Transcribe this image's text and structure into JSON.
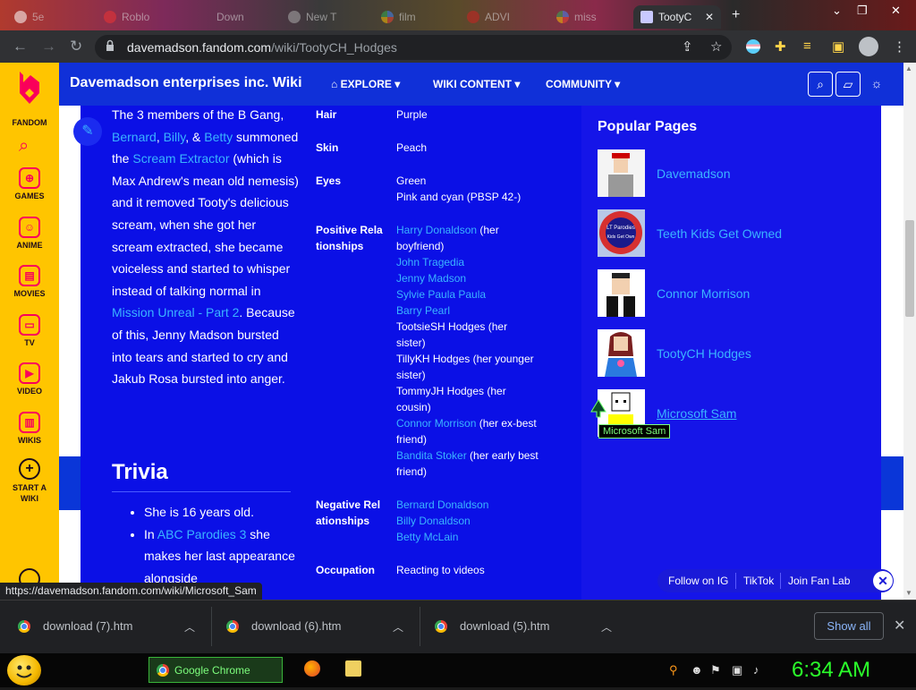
{
  "browser": {
    "tabs": [
      {
        "label": "5e"
      },
      {
        "label": "Roblo"
      },
      {
        "label": "Down"
      },
      {
        "label": "New T"
      },
      {
        "label": "film"
      },
      {
        "label": "ADVI"
      },
      {
        "label": "miss"
      },
      {
        "label": "TootyC"
      }
    ],
    "new_tab_label": "+",
    "url_domain": "davemadson.fandom.com",
    "url_path": "/wiki/TootyCH_Hodges"
  },
  "fandom_rail": {
    "logo_label": "FANDOM",
    "items": [
      {
        "label": "GAMES",
        "icon": "gamepad-icon"
      },
      {
        "label": "ANIME",
        "icon": "anime-icon"
      },
      {
        "label": "MOVIES",
        "icon": "movies-icon"
      },
      {
        "label": "TV",
        "icon": "tv-icon"
      },
      {
        "label": "VIDEO",
        "icon": "video-icon"
      },
      {
        "label": "WIKIS",
        "icon": "book-icon"
      },
      {
        "label": "START A WIKI",
        "icon": "plus-icon"
      }
    ]
  },
  "wiki_header": {
    "title": "Davemadson enterprises inc. Wiki",
    "nav": [
      "EXPLORE",
      "WIKI CONTENT",
      "COMMUNITY"
    ]
  },
  "article": {
    "paragraph": [
      {
        "t": "The 3 members of the B Gang, "
      },
      {
        "t": "Bernard",
        "link": true
      },
      {
        "t": ", "
      },
      {
        "t": "Billy",
        "link": true
      },
      {
        "t": ", & "
      },
      {
        "t": "Betty",
        "link": true
      },
      {
        "t": " summoned the "
      },
      {
        "t": "Scream Extractor",
        "link": true
      },
      {
        "t": " (which is Max Andrew's mean old nemesis) and it removed Tooty's delicious scream, when she got her scream extracted, she became voiceless and started to whisper instead of talking normal in "
      },
      {
        "t": "Mission Unreal - Part 2",
        "link": true
      },
      {
        "t": ". Because of this, Jenny Madson bursted into tears and started to cry and Jakub Rosa bursted into anger."
      }
    ],
    "trivia_heading": "Trivia",
    "trivia_items": [
      [
        {
          "t": "She is 16 years old."
        }
      ],
      [
        {
          "t": "In "
        },
        {
          "t": "ABC Parodies 3",
          "link": true
        },
        {
          "t": " she makes her last appearance alongside"
        }
      ]
    ]
  },
  "infobox": [
    {
      "label": "Hair",
      "values": [
        [
          {
            "t": "Purple"
          }
        ]
      ]
    },
    {
      "label": "Skin",
      "values": [
        [
          {
            "t": "Peach"
          }
        ]
      ]
    },
    {
      "label": "Eyes",
      "values": [
        [
          {
            "t": "Green"
          }
        ],
        [
          {
            "t": "Pink and cyan (PBSP 42-)"
          }
        ]
      ]
    },
    {
      "label": "Positive Relationships",
      "values": [
        [
          {
            "t": "Harry Donaldson",
            "link": true
          },
          {
            "t": " (her boyfriend)"
          }
        ],
        [
          {
            "t": "John Tragedia",
            "link": true
          }
        ],
        [
          {
            "t": "Jenny Madson",
            "link": true
          }
        ],
        [
          {
            "t": "Sylvie Paula Paula",
            "link": true
          }
        ],
        [
          {
            "t": "Barry Pearl",
            "link": true
          }
        ],
        [
          {
            "t": "TootsieSH Hodges (her sister)"
          }
        ],
        [
          {
            "t": "TillyKH Hodges (her younger sister)"
          }
        ],
        [
          {
            "t": "TommyJH Hodges (her cousin)"
          }
        ],
        [
          {
            "t": "Connor Morrison",
            "link": true
          },
          {
            "t": " (her ex-best friend)"
          }
        ],
        [
          {
            "t": "Bandita Stoker",
            "link": true
          },
          {
            "t": " (her early best friend)"
          }
        ]
      ]
    },
    {
      "label": "Negative Relationships",
      "values": [
        [
          {
            "t": "Bernard Donaldson",
            "link": true
          }
        ],
        [
          {
            "t": "Billy Donaldson",
            "link": true
          }
        ],
        [
          {
            "t": "Betty McLain",
            "link": true
          }
        ]
      ]
    },
    {
      "label": "Occupation",
      "values": [
        [
          {
            "t": "Reacting to videos"
          }
        ]
      ]
    }
  ],
  "popular_pages": {
    "title": "Popular Pages",
    "items": [
      {
        "label": "Davemadson"
      },
      {
        "label": "Teeth Kids Get Owned",
        "thumb_text": "LT Parodies Episode 246: Teeth Kids Get Owned"
      },
      {
        "label": "Connor Morrison"
      },
      {
        "label": "TootyCH Hodges"
      },
      {
        "label": "Microsoft Sam"
      }
    ],
    "tooltip": "Microsoft Sam"
  },
  "follow_bar": {
    "items": [
      "Follow on IG",
      "TikTok",
      "Join Fan Lab"
    ]
  },
  "status_url": "https://davemadson.fandom.com/wiki/Microsoft_Sam",
  "downloads": {
    "items": [
      "download (7).htm",
      "download (6).htm",
      "download (5).htm"
    ],
    "show_all": "Show all"
  },
  "taskbar": {
    "chrome_label": "Google Chrome",
    "clock": "6:34 AM"
  },
  "colors": {
    "fandom_yellow": "#ffc500",
    "wiki_blue": "#0a0af0",
    "link": "#3ab4ff",
    "clock_green": "#2bff2b"
  }
}
